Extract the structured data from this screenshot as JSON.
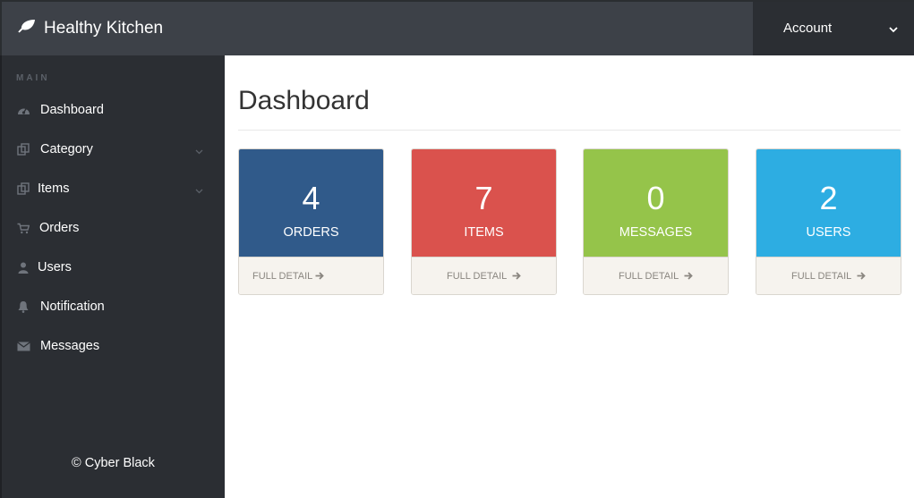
{
  "app": {
    "brand_name": "Healthy Kitchen",
    "brand_icon": "leaf-icon"
  },
  "header": {
    "account_label": "Account",
    "account_icon": "chevron-down-icon"
  },
  "sidebar": {
    "section_label": "MAIN",
    "items": [
      {
        "label": "Dashboard",
        "icon": "dashboard-icon",
        "has_submenu": false
      },
      {
        "label": "Category",
        "icon": "copy-icon",
        "has_submenu": true
      },
      {
        "label": "Items",
        "icon": "copy-icon",
        "has_submenu": true
      },
      {
        "label": "Orders",
        "icon": "cart-icon",
        "has_submenu": false
      },
      {
        "label": "Users",
        "icon": "user-icon",
        "has_submenu": false
      },
      {
        "label": "Notification",
        "icon": "bell-icon",
        "has_submenu": false
      },
      {
        "label": "Messages",
        "icon": "envelope-icon",
        "has_submenu": false
      }
    ],
    "footer": "© Cyber Black"
  },
  "main": {
    "title": "Dashboard",
    "cards": [
      {
        "count": "4",
        "label": "ORDERS",
        "link": "FULL DETAIL",
        "color": "#305a8a"
      },
      {
        "count": "7",
        "label": "ITEMS",
        "link": "FULL DETAIL",
        "color": "#da524d"
      },
      {
        "count": "0",
        "label": "MESSAGES",
        "link": "FULL DETAIL",
        "color": "#95c44a"
      },
      {
        "count": "2",
        "label": "USERS",
        "link": "FULL DETAIL",
        "color": "#2dade2"
      }
    ]
  },
  "colors": {
    "topbar": "#3d4148",
    "sidebar": "#2b2e33",
    "card_footer": "#f6f3ee"
  }
}
